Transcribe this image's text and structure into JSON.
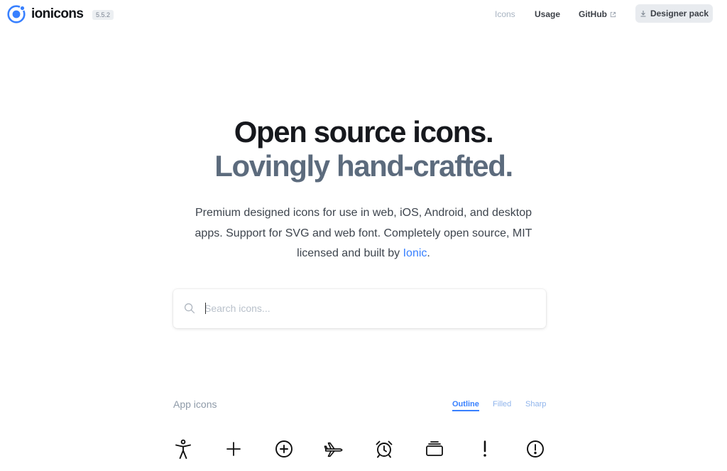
{
  "header": {
    "brand": "ionicons",
    "version": "5.5.2",
    "nav": {
      "icons": "Icons",
      "usage": "Usage",
      "github": "GitHub"
    },
    "designer_pack": "Designer pack"
  },
  "hero": {
    "line1": "Open source icons.",
    "line2": "Lovingly hand-crafted.",
    "desc_before_link": "Premium designed icons for use in web, iOS, Android, and desktop apps. Support for SVG and web font. Completely open source, MIT licensed and built by ",
    "desc_link": "Ionic",
    "desc_after_link": "."
  },
  "search": {
    "placeholder": "Search icons..."
  },
  "section": {
    "title": "App icons",
    "tabs": [
      "Outline",
      "Filled",
      "Sharp"
    ],
    "active_tab": "Outline",
    "icons": [
      "accessibility-icon",
      "add-icon",
      "add-circle-icon",
      "airplane-icon",
      "alarm-icon",
      "albums-icon",
      "alert-icon",
      "alert-circle-icon"
    ]
  },
  "colors": {
    "accent": "#3880ff",
    "title_dark": "#16181d",
    "title_slate": "#5c6b7d"
  }
}
